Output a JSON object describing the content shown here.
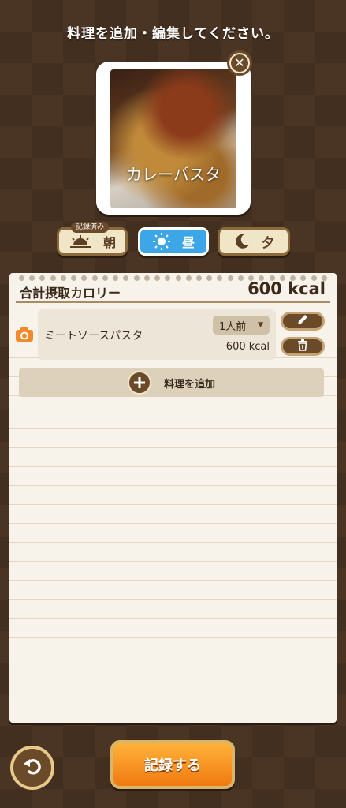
{
  "header": {
    "title": "料理を追加・編集してください。"
  },
  "photo": {
    "caption": "カレーパスタ"
  },
  "meal_tabs": [
    {
      "label": "朝",
      "icon": "sunrise-icon",
      "badge": "記録済み",
      "active": false
    },
    {
      "label": "昼",
      "icon": "sun-icon",
      "active": true
    },
    {
      "label": "夕",
      "icon": "moon-icon",
      "active": false
    }
  ],
  "summary": {
    "label": "合計摂取カロリー",
    "value": "600 kcal"
  },
  "food_items": [
    {
      "name": "ミートソースパスタ",
      "portion": "1人前",
      "kcal": "600 kcal",
      "icon": "camera-icon"
    }
  ],
  "add_dish": {
    "label": "料理を追加"
  },
  "footer": {
    "record_label": "記録する"
  },
  "colors": {
    "accent_blue": "#3da6e6",
    "brown": "#6b4a2a",
    "orange": "#f07a10"
  }
}
